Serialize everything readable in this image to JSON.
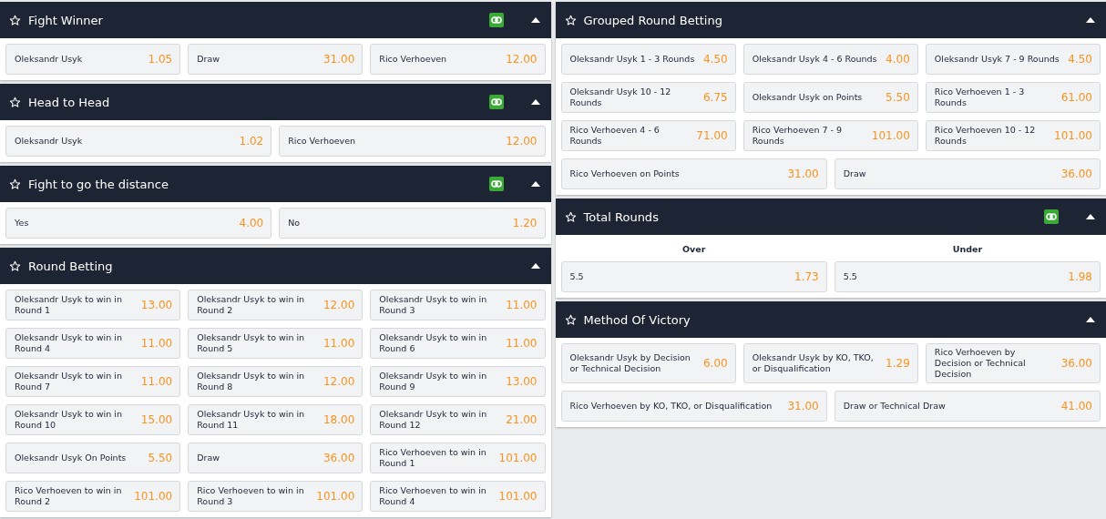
{
  "columns": [
    {
      "markets": [
        {
          "title": "Fight Winner",
          "cash_out": true,
          "expanded": true,
          "rows": [
            [
              {
                "label": "Oleksandr Usyk",
                "odds": "1.05"
              },
              {
                "label": "Draw",
                "odds": "31.00"
              },
              {
                "label": "Rico Verhoeven",
                "odds": "12.00"
              }
            ]
          ]
        },
        {
          "title": "Head to Head",
          "cash_out": true,
          "expanded": true,
          "rows": [
            [
              {
                "label": "Oleksandr Usyk",
                "odds": "1.02"
              },
              {
                "label": "Rico Verhoeven",
                "odds": "12.00"
              }
            ]
          ]
        },
        {
          "title": "Fight to go the distance",
          "cash_out": true,
          "expanded": true,
          "rows": [
            [
              {
                "label": "Yes",
                "odds": "4.00"
              },
              {
                "label": "No",
                "odds": "1.20"
              }
            ]
          ]
        },
        {
          "title": "Round Betting",
          "cash_out": false,
          "expanded": true,
          "rows": [
            [
              {
                "label": "Oleksandr Usyk to win in Round 1",
                "odds": "13.00"
              },
              {
                "label": "Oleksandr Usyk to win in Round 2",
                "odds": "12.00"
              },
              {
                "label": "Oleksandr Usyk to win in Round 3",
                "odds": "11.00"
              }
            ],
            [
              {
                "label": "Oleksandr Usyk to win in Round 4",
                "odds": "11.00"
              },
              {
                "label": "Oleksandr Usyk to win in Round 5",
                "odds": "11.00"
              },
              {
                "label": "Oleksandr Usyk to win in Round 6",
                "odds": "11.00"
              }
            ],
            [
              {
                "label": "Oleksandr Usyk to win in Round 7",
                "odds": "11.00"
              },
              {
                "label": "Oleksandr Usyk to win in Round 8",
                "odds": "12.00"
              },
              {
                "label": "Oleksandr Usyk to win in Round 9",
                "odds": "13.00"
              }
            ],
            [
              {
                "label": "Oleksandr Usyk to win in Round 10",
                "odds": "15.00"
              },
              {
                "label": "Oleksandr Usyk to win in Round 11",
                "odds": "18.00"
              },
              {
                "label": "Oleksandr Usyk to win in Round 12",
                "odds": "21.00"
              }
            ],
            [
              {
                "label": "Oleksandr Usyk On Points",
                "odds": "5.50"
              },
              {
                "label": "Draw",
                "odds": "36.00"
              },
              {
                "label": "Rico Verhoeven to win in Round 1",
                "odds": "101.00"
              }
            ],
            [
              {
                "label": "Rico Verhoeven to win in Round 2",
                "odds": "101.00"
              },
              {
                "label": "Rico Verhoeven to win in Round 3",
                "odds": "101.00"
              },
              {
                "label": "Rico Verhoeven to win in Round 4",
                "odds": "101.00"
              }
            ]
          ]
        }
      ]
    },
    {
      "markets": [
        {
          "title": "Grouped Round Betting",
          "cash_out": false,
          "expanded": true,
          "rows": [
            [
              {
                "label": "Oleksandr Usyk 1 - 3 Rounds",
                "odds": "4.50"
              },
              {
                "label": "Oleksandr Usyk 4 - 6 Rounds",
                "odds": "4.00"
              },
              {
                "label": "Oleksandr Usyk 7 - 9 Rounds",
                "odds": "4.50"
              }
            ],
            [
              {
                "label": "Oleksandr Usyk 10 - 12 Rounds",
                "odds": "6.75"
              },
              {
                "label": "Oleksandr Usyk on Points",
                "odds": "5.50"
              },
              {
                "label": "Rico Verhoeven 1 - 3 Rounds",
                "odds": "61.00"
              }
            ],
            [
              {
                "label": "Rico Verhoeven 4 - 6 Rounds",
                "odds": "71.00"
              },
              {
                "label": "Rico Verhoeven 7 - 9 Rounds",
                "odds": "101.00"
              },
              {
                "label": "Rico Verhoeven 10 - 12 Rounds",
                "odds": "101.00"
              }
            ],
            [
              {
                "label": "Rico Verhoeven on Points",
                "odds": "31.00"
              },
              {
                "label": "Draw",
                "odds": "36.00"
              }
            ]
          ]
        },
        {
          "title": "Total Rounds",
          "cash_out": true,
          "expanded": true,
          "column_labels": [
            "Over",
            "Under"
          ],
          "rows": [
            [
              {
                "label": "5.5",
                "odds": "1.73"
              },
              {
                "label": "5.5",
                "odds": "1.98"
              }
            ]
          ]
        },
        {
          "title": "Method Of Victory",
          "cash_out": false,
          "expanded": true,
          "rows": [
            [
              {
                "label": "Oleksandr Usyk by Decision or Technical Decision",
                "odds": "6.00"
              },
              {
                "label": "Oleksandr Usyk by KO, TKO, or Disqualification",
                "odds": "1.29"
              },
              {
                "label": "Rico Verhoeven by Decision or Technical Decision",
                "odds": "36.00"
              }
            ],
            [
              {
                "label": "Rico Verhoeven by KO, TKO, or Disqualification",
                "odds": "31.00"
              },
              {
                "label": "Draw or Technical Draw",
                "odds": "41.00"
              }
            ]
          ]
        }
      ]
    }
  ]
}
